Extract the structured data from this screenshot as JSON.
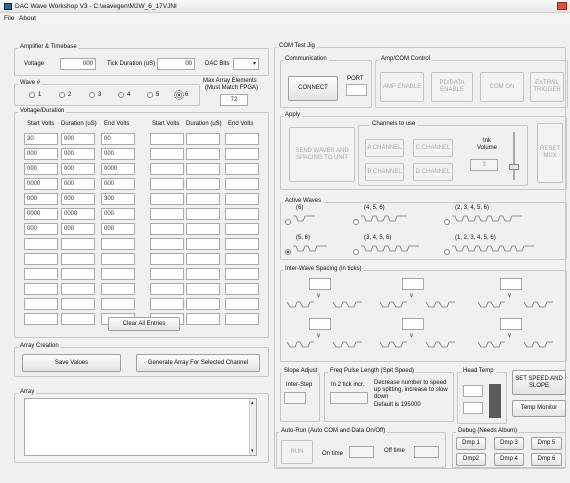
{
  "window": {
    "title": "DAC Wave Workshop V3 - C:\\wavegen\\M2W_6_17VJNI"
  },
  "menu": [
    "File",
    "About"
  ],
  "amp": {
    "legend": "Amplifier & Timebase",
    "voltage_label": "Voltage",
    "voltage_value": "000",
    "tick_label": "Tick Duration (uS)",
    "tick_value": "00",
    "dacbits_label": "DAC Bits"
  },
  "wave": {
    "label": "Wave #",
    "options": [
      "1",
      "2",
      "3",
      "4",
      "5",
      "6"
    ],
    "selected": "6",
    "max_label_1": "Max Array Elements",
    "max_label_2": "(Must Match FPGA)",
    "max_value": "72"
  },
  "vd": {
    "legend": "Voltage/Duration",
    "headers": [
      "Start Volts",
      "Duration (uS)",
      "End Volts",
      "Start Volts",
      "Duration (uS)",
      "End Volts"
    ],
    "rows": [
      [
        "30",
        "000",
        "00"
      ],
      [
        "000",
        "000",
        "000"
      ],
      [
        "000",
        "000",
        "0000"
      ],
      [
        "0000",
        "000",
        "000"
      ],
      [
        "000",
        "000",
        "300"
      ],
      [
        "0000",
        "0000",
        "000"
      ],
      [
        "000",
        "000",
        "000"
      ]
    ],
    "clear_label": "Clear All Entries"
  },
  "array_creation": {
    "legend": "Array Creation",
    "save_label": "Save Values",
    "generate_label": "Generate Array For Selected Channel"
  },
  "array": {
    "legend": "Array"
  },
  "com": {
    "legend": "COM Test Jig",
    "comm_legend": "Communication",
    "port_label": "PORT",
    "connect_label": "CONNECT",
    "ampcom_legend": "Amp/COM Control",
    "amp_enable": "AMP ENABLE",
    "pd_enable": "PD/DATA ENABLE",
    "com_on": "COM ON",
    "ext_trigger": "EXTRNL TRIGGER"
  },
  "apply": {
    "legend": "Apply",
    "send_label": "SEND WAVES AND SPACING TO UNIT",
    "channels_legend": "Channels to use",
    "a_channel": "A CHANNEL",
    "b_channel": "B CHANNEL",
    "c_channel": "C CHANNEL",
    "d_channel": "D CHANNEL",
    "ink_label": "Ink Volume",
    "ink_value": "3",
    "reset_label": "RESET MUX"
  },
  "active_waves": {
    "legend": "Active Waves",
    "items": [
      "(6)",
      "(4, 5, 6)",
      "(2, 3, 4, 5, 6)",
      "(5, 6)",
      "(3, 4, 5, 6)",
      "(1, 2, 3, 4, 5, 6)"
    ]
  },
  "spacing": {
    "legend": "Inter-Wave Spacing (in ticks)",
    "v": "v"
  },
  "slope": {
    "legend": "Slope Adjust",
    "label": "Inter-Step"
  },
  "freq": {
    "legend": "Freq Pulse Length (Spit Speed)",
    "label": "In 2 tick incr.",
    "note": "Decrease number to speed up spitting, increase to slow down",
    "default": "Default is 195000"
  },
  "head": {
    "legend": "Head Temp"
  },
  "set_speed_label": "SET SPEED AND SLOPE",
  "temp_monitor_label": "Temp Monitor",
  "autorun": {
    "legend": "Auto-Run (Auto COM and Data On/Off)",
    "run": "RUN",
    "on_label": "On time",
    "off_label": "Off time"
  },
  "debug": {
    "legend": "Debug (Needs Album)",
    "buttons": [
      "Dmp 1",
      "Dmp 3",
      "Dmp 5",
      "Dmp2",
      "Dmp 4",
      "Dmp 6"
    ]
  }
}
